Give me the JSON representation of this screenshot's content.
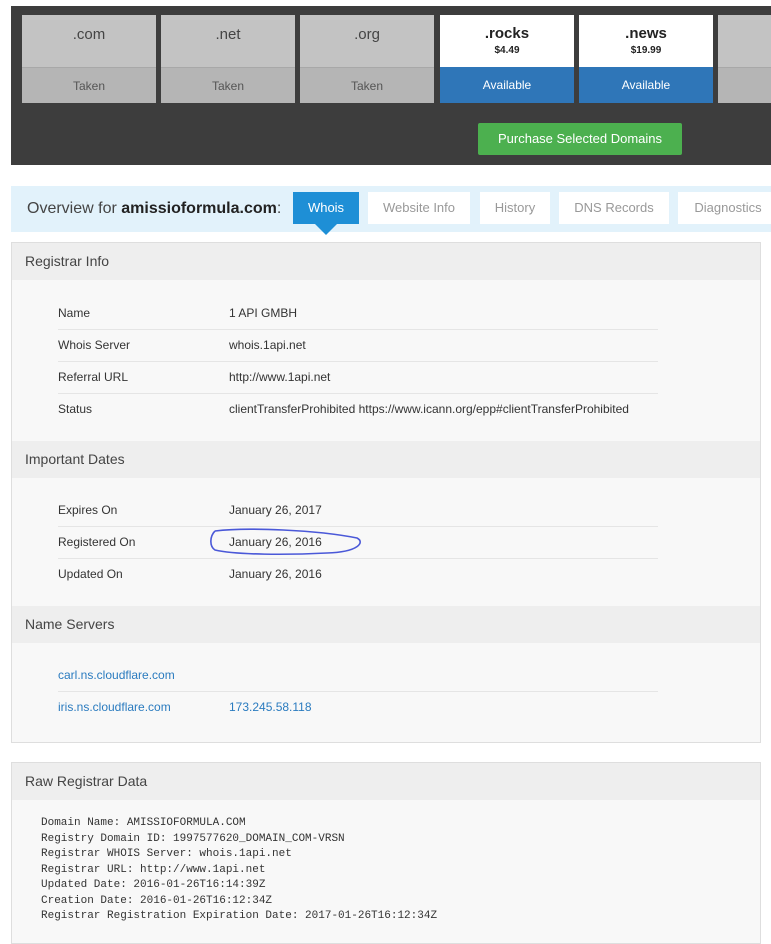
{
  "tlds": [
    {
      "ext": ".com",
      "state": "Taken"
    },
    {
      "ext": ".net",
      "state": "Taken"
    },
    {
      "ext": ".org",
      "state": "Taken"
    },
    {
      "ext": ".rocks",
      "price": "$4.49",
      "state": "Available"
    },
    {
      "ext": ".news",
      "price": "$19.99",
      "state": "Available"
    }
  ],
  "purchase_label": "Purchase Selected Domains",
  "overview": {
    "prefix": "Overview for",
    "domain": "amissioformula.com",
    "suffix": ":",
    "tabs": [
      "Whois",
      "Website Info",
      "History",
      "DNS Records",
      "Diagnostics"
    ]
  },
  "registrar": {
    "title": "Registrar Info",
    "rows": [
      {
        "key": "Name",
        "value": "1 API GMBH"
      },
      {
        "key": "Whois Server",
        "value": "whois.1api.net"
      },
      {
        "key": "Referral URL",
        "value": "http://www.1api.net"
      },
      {
        "key": "Status",
        "value": "clientTransferProhibited https://www.icann.org/epp#clientTransferProhibited"
      }
    ]
  },
  "dates": {
    "title": "Important Dates",
    "rows": [
      {
        "key": "Expires On",
        "value": "January 26, 2017"
      },
      {
        "key": "Registered On",
        "value": "January 26, 2016"
      },
      {
        "key": "Updated On",
        "value": "January 26, 2016"
      }
    ]
  },
  "nameservers": {
    "title": "Name Servers",
    "rows": [
      {
        "host": "carl.ns.cloudflare.com",
        "ip": ""
      },
      {
        "host": "iris.ns.cloudflare.com",
        "ip": "173.245.58.118"
      }
    ]
  },
  "raw": {
    "title": "Raw Registrar Data",
    "text": "Domain Name: AMISSIOFORMULA.COM\nRegistry Domain ID: 1997577620_DOMAIN_COM-VRSN\nRegistrar WHOIS Server: whois.1api.net\nRegistrar URL: http://www.1api.net\nUpdated Date: 2016-01-26T16:14:39Z\nCreation Date: 2016-01-26T16:12:34Z\nRegistrar Registration Expiration Date: 2017-01-26T16:12:34Z"
  },
  "colors": {
    "accent": "#1e8fd6",
    "available": "#2f76b8",
    "purchase": "#4cb04f",
    "annotation": "#4a58d8"
  }
}
